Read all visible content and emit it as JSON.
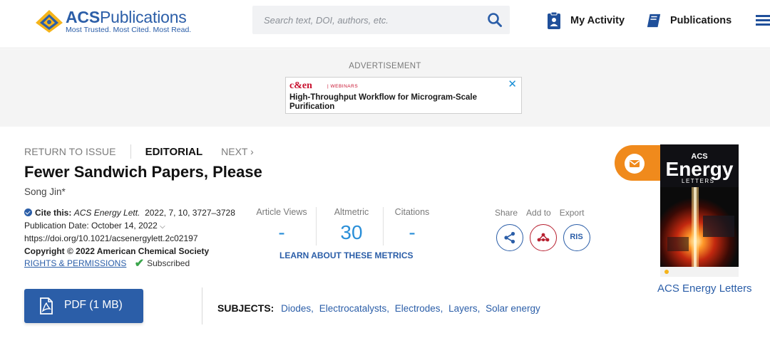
{
  "header": {
    "logo_title_strong": "ACS",
    "logo_title_rest": "Publications",
    "logo_tagline": "Most Trusted. Most Cited. Most Read.",
    "search_placeholder": "Search text, DOI, authors, etc.",
    "my_activity_label": "My Activity",
    "publications_label": "Publications"
  },
  "ad": {
    "label": "ADVERTISEMENT",
    "brand": "c&en",
    "brand_sub": "| WEBINARS",
    "headline": "High-Throughput Workflow for Microgram-Scale Purification",
    "close": "✕"
  },
  "article_nav": {
    "return_label": "RETURN TO ISSUE",
    "type_label": "EDITORIAL",
    "next_label": "NEXT ›"
  },
  "article": {
    "title": "Fewer Sandwich Papers, Please",
    "author": "Song Jin*",
    "cite_label": "Cite this:",
    "cite_journal": "ACS Energy Lett.",
    "cite_details": "2022, 7, 10, 3727–3728",
    "pub_date": "Publication Date: October 14, 2022",
    "pub_date_chevron": "⌵",
    "doi": "https://doi.org/10.1021/acsenergylett.2c02197",
    "copyright": "Copyright © 2022 American Chemical Society",
    "rights_link": "RIGHTS & PERMISSIONS",
    "subscribed": "Subscribed"
  },
  "metrics": {
    "views_label": "Article Views",
    "views_value": "-",
    "altmetric_label": "Altmetric",
    "altmetric_value": "30",
    "citations_label": "Citations",
    "citations_value": "-",
    "learn_more": "LEARN ABOUT THESE METRICS"
  },
  "actions": {
    "share_label": "Share",
    "add_label": "Add to",
    "export_label": "Export",
    "ris_label": "RIS"
  },
  "cover": {
    "journal_name": "ACS Energy Letters",
    "cover_acs": "ACS",
    "cover_energy": "Energy",
    "cover_letters": "LETTERS"
  },
  "pdf": {
    "label": "PDF (1 MB)"
  },
  "subjects": {
    "label": "SUBJECTS:",
    "items": [
      "Diodes",
      "Electrocatalysts",
      "Electrodes",
      "Layers",
      "Solar energy"
    ]
  },
  "colors": {
    "brand_blue": "#2b5ea8",
    "metric_blue": "#2b8fd8",
    "add_red": "#b72030",
    "mail_orange": "#f08a1c",
    "check_green": "#3aa54b"
  },
  "icons": [
    "acs-logo-icon",
    "search-icon",
    "activity-icon",
    "publications-icon",
    "menu-icon",
    "close-icon",
    "check-circle-icon",
    "checkmark-icon",
    "share-icon",
    "add-to-icon",
    "mail-icon",
    "pdf-icon"
  ]
}
